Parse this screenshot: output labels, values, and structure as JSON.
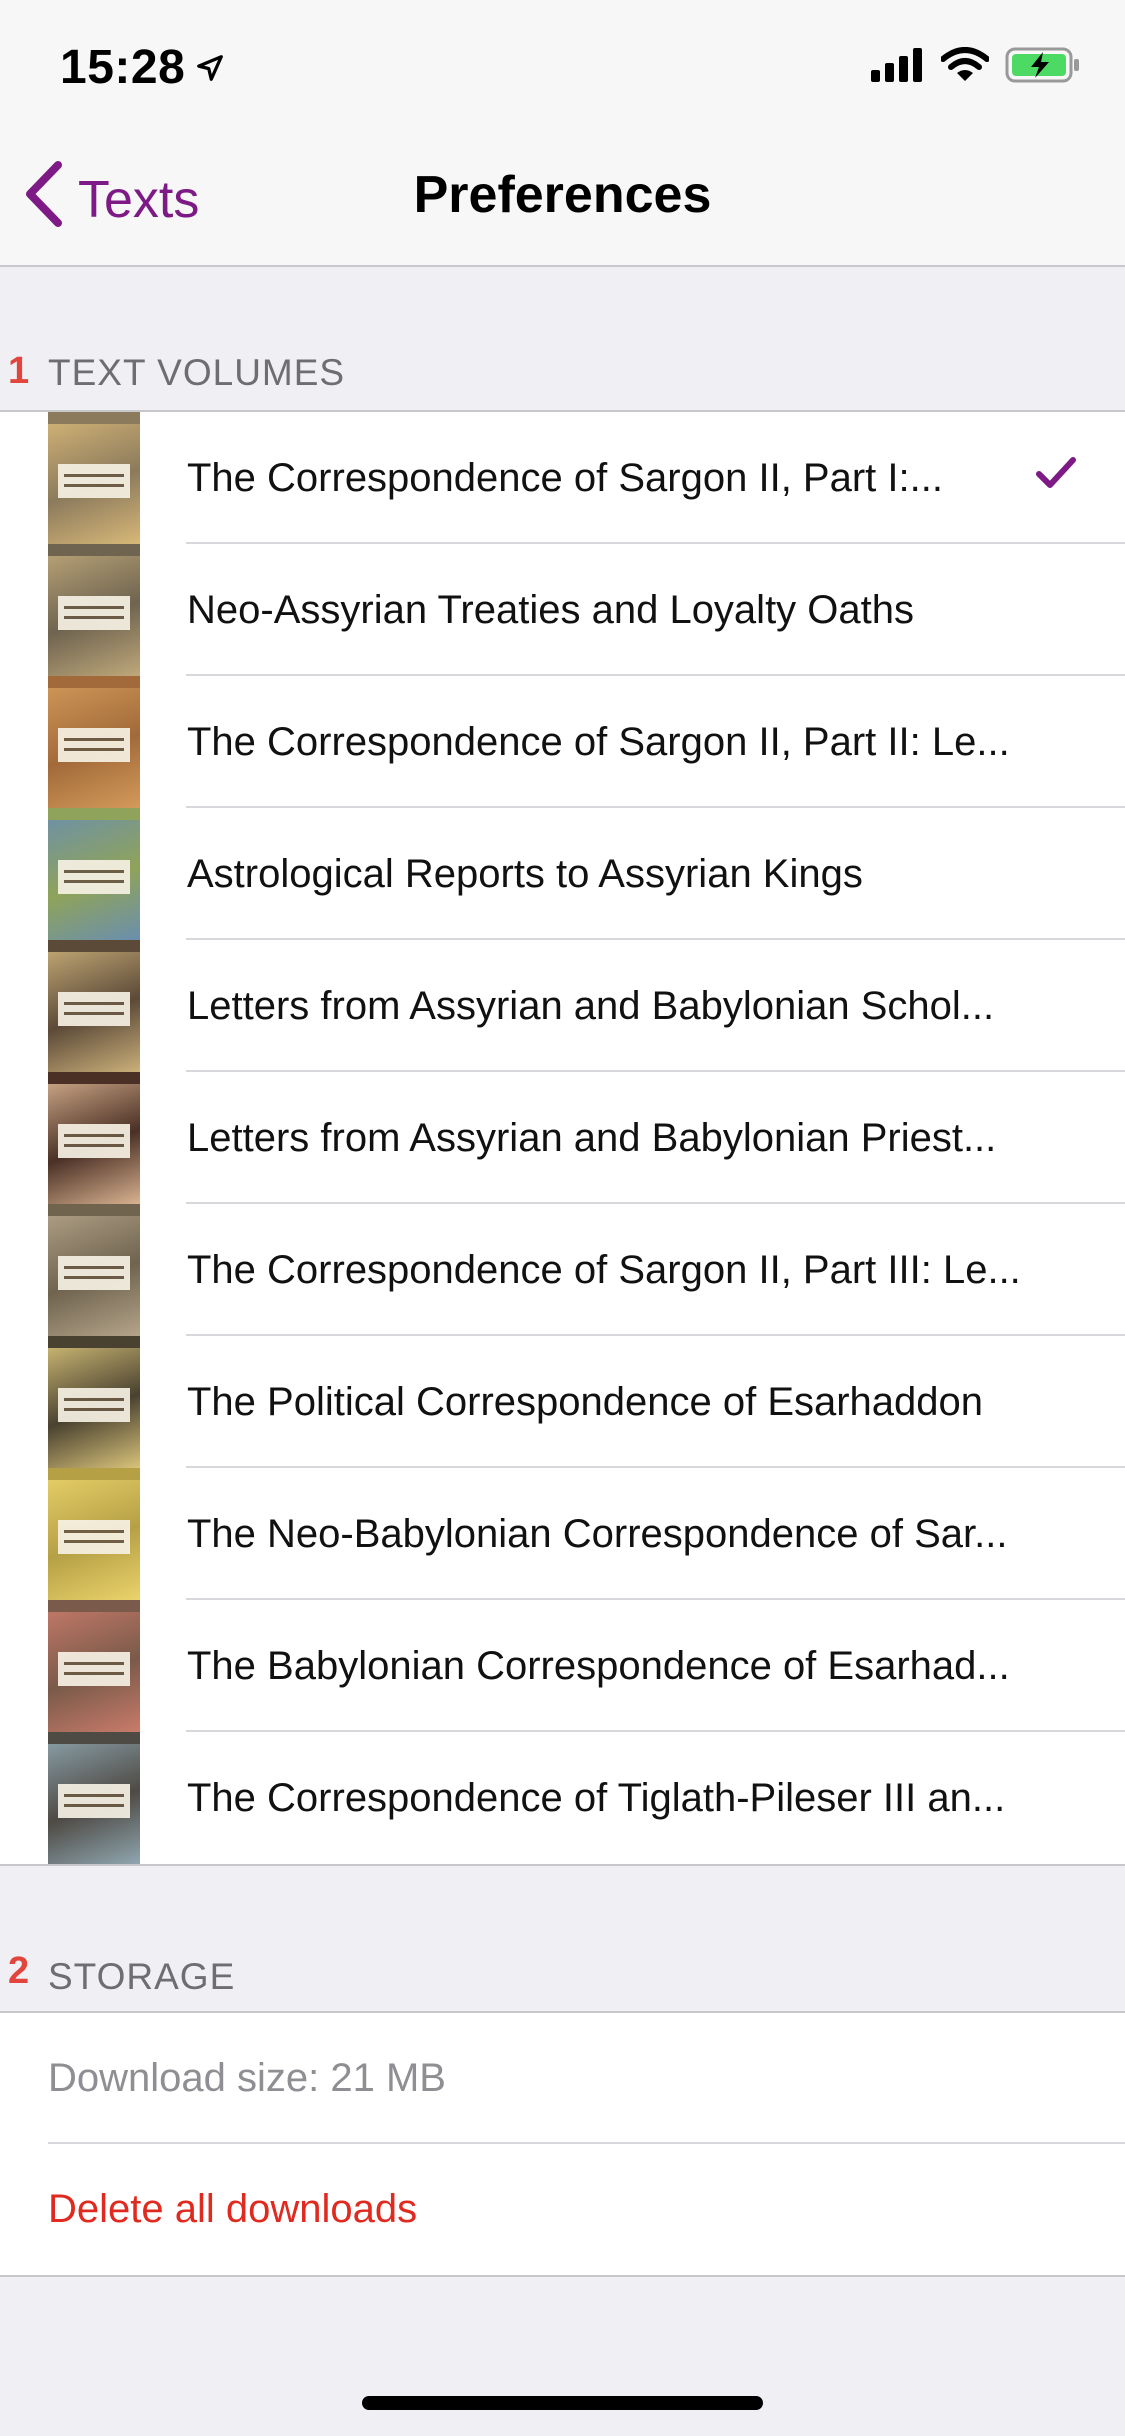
{
  "status_bar": {
    "time": "15:28",
    "location_icon": "location-arrow-icon",
    "signal_icon": "cellular-signal-icon",
    "wifi_icon": "wifi-icon",
    "battery_icon": "battery-charging-icon"
  },
  "nav": {
    "back_label": "Texts",
    "title": "Preferences"
  },
  "accent_color": "#7d1a85",
  "destructive_color": "#e02a1f",
  "sections": [
    {
      "number": "1",
      "title": "TEXT VOLUMES",
      "items": [
        {
          "label": "The Correspondence of Sargon II, Part I:...",
          "selected": true,
          "cover": [
            "#d8b878",
            "#8b7a5c"
          ]
        },
        {
          "label": "Neo-Assyrian Treaties and Loyalty Oaths",
          "selected": false,
          "cover": [
            "#bfa87a",
            "#6f6450"
          ]
        },
        {
          "label": "The Correspondence of Sargon II, Part II: Le...",
          "selected": false,
          "cover": [
            "#d49a5a",
            "#a26a3a"
          ]
        },
        {
          "label": "Astrological Reports to Assyrian Kings",
          "selected": false,
          "cover": [
            "#6a8fae",
            "#8fa35a"
          ]
        },
        {
          "label": "Letters from Assyrian and Babylonian Schol...",
          "selected": false,
          "cover": [
            "#cbb07a",
            "#5c4a38"
          ]
        },
        {
          "label": "Letters from Assyrian and Babylonian Priest...",
          "selected": false,
          "cover": [
            "#d9b290",
            "#4a3025"
          ]
        },
        {
          "label": "The Correspondence of Sargon II, Part III: Le...",
          "selected": false,
          "cover": [
            "#b4a48a",
            "#70644f"
          ]
        },
        {
          "label": "The Political Correspondence of Esarhaddon",
          "selected": false,
          "cover": [
            "#d9c37a",
            "#4a4230"
          ]
        },
        {
          "label": "The Neo-Babylonian Correspondence of Sar...",
          "selected": false,
          "cover": [
            "#ead36a",
            "#b6a046"
          ]
        },
        {
          "label": "The Babylonian Correspondence of Esarhad...",
          "selected": false,
          "cover": [
            "#c97b6a",
            "#7a5a4a"
          ]
        },
        {
          "label": "The Correspondence of Tiglath-Pileser III an...",
          "selected": false,
          "cover": [
            "#8fa6b0",
            "#4e4a44"
          ]
        }
      ]
    },
    {
      "number": "2",
      "title": "STORAGE",
      "download_size": "Download size: 21 MB",
      "delete_label": "Delete all downloads"
    }
  ]
}
